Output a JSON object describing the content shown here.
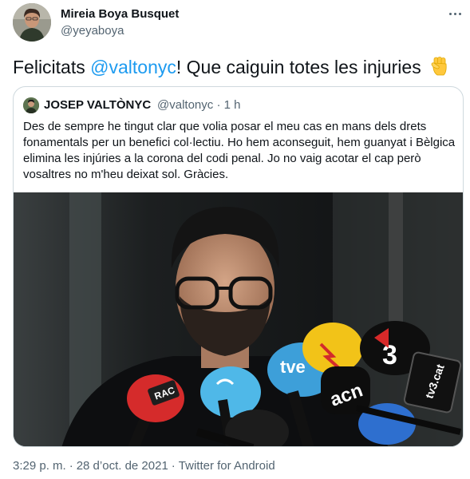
{
  "author": {
    "name": "Mireia Boya Busquet",
    "handle": "@yeyaboya",
    "avatar": "avatar"
  },
  "tweet": {
    "text_before": "Felicitats ",
    "mention": "@valtonyc",
    "text_after": "! Que caiguin totes les injuries",
    "emoji": "raised-fist-icon"
  },
  "quoted_tweet": {
    "name": "JOSEP VALTÒNYC",
    "handle": "@valtonyc",
    "separator": "·",
    "time": "1 h",
    "text": "Des de sempre he tingut clar que volia posar el meu cas en mans dels drets fonamentals per un benefici col·lectiu. Ho hem aconseguit, hem guanyat i Bèlgica elimina les injúries a la corona del codi penal. Jo no vaig acotar el cap però vosaltres no m'heu deixat sol. Gràcies.",
    "photo": {
      "microphones": [
        "RAC",
        "tve",
        "3",
        "acn",
        "tv3.cat"
      ]
    }
  },
  "footer": {
    "time": "3:29 p. m.",
    "date": "28 d’oct. de 2021",
    "client": "Twitter for Android",
    "separator": "·"
  },
  "colors": {
    "accent": "#1d9bf0",
    "text": "#0f1419",
    "secondary": "#536471",
    "border": "#cfd9de"
  }
}
